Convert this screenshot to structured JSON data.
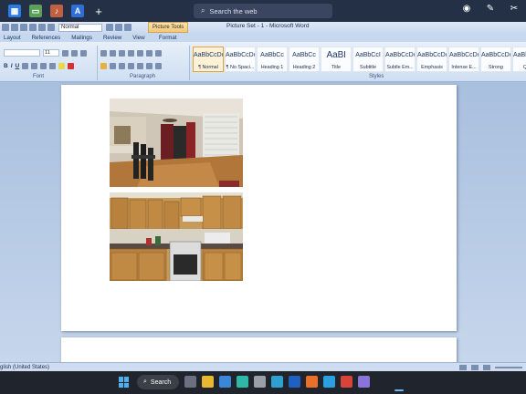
{
  "window": {
    "search_placeholder": "Search the web",
    "doc_title": "Picture Set - 1 - Microsoft Word",
    "context_tab_group": "Picture Tools"
  },
  "quick_access": {
    "style_value": "Normal"
  },
  "tabs": [
    "Layout",
    "References",
    "Mailings",
    "Review",
    "View"
  ],
  "context_tab": "Format",
  "ribbon": {
    "font_size": "11",
    "groups": [
      "Font",
      "Paragraph",
      "Styles"
    ],
    "styles": [
      {
        "preview": "AaBbCcDc",
        "name": "¶ Normal",
        "active": true
      },
      {
        "preview": "AaBbCcDc",
        "name": "¶ No Spaci...",
        "active": false
      },
      {
        "preview": "AaBbCc",
        "name": "Heading 1",
        "active": false
      },
      {
        "preview": "AaBbCc",
        "name": "Heading 2",
        "active": false
      },
      {
        "preview": "AaBl",
        "name": "Title",
        "active": false
      },
      {
        "preview": "AaBbCcI",
        "name": "Subtitle",
        "active": false
      },
      {
        "preview": "AaBbCcDc",
        "name": "Subtle Em...",
        "active": false
      },
      {
        "preview": "AaBbCcDc",
        "name": "Emphasis",
        "active": false
      },
      {
        "preview": "AaBbCcDc",
        "name": "Intense E...",
        "active": false
      },
      {
        "preview": "AaBbCcDc",
        "name": "Strong",
        "active": false
      },
      {
        "preview": "AaBbCcDc",
        "name": "Quo",
        "active": false
      }
    ]
  },
  "status_bar": {
    "language": "glish (United States)"
  },
  "taskbar": {
    "search_label": "Search"
  },
  "colors": {
    "topbar": "#243046",
    "ribbon": "#dfe9f6",
    "taskbar": "#20242c",
    "accent": "#e4a23a"
  }
}
